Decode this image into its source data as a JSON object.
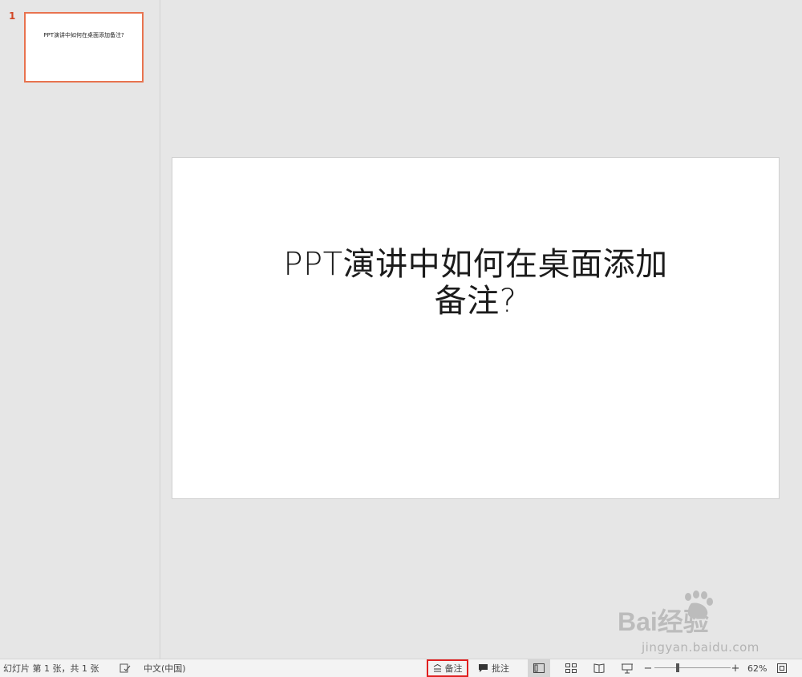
{
  "thumbnails": [
    {
      "number": "1",
      "title": "PPT演讲中如何在桌面添加备注?"
    }
  ],
  "slide": {
    "title_line1": "PPT演讲中如何在桌面添加",
    "title_line2": "备注?"
  },
  "status_bar": {
    "slide_info": "幻灯片 第 1 张，共 1 张",
    "language": "中文(中国)",
    "notes_label": "备注",
    "comments_label": "批注",
    "zoom": "62%",
    "zoom_fraction": 0.3
  },
  "watermark": {
    "brand": "Bai经验",
    "url": "jingyan.baidu.com"
  },
  "icons": {
    "notes": "notes-icon",
    "comments": "comment-icon",
    "normal_view": "normal-view-icon",
    "sorter_view": "slide-sorter-icon",
    "reading_view": "reading-view-icon",
    "slideshow": "slideshow-icon",
    "fit": "fit-to-window-icon",
    "spell": "proofing-icon"
  },
  "colors": {
    "selection_border": "#e8734f",
    "highlight_box": "#e02020"
  }
}
